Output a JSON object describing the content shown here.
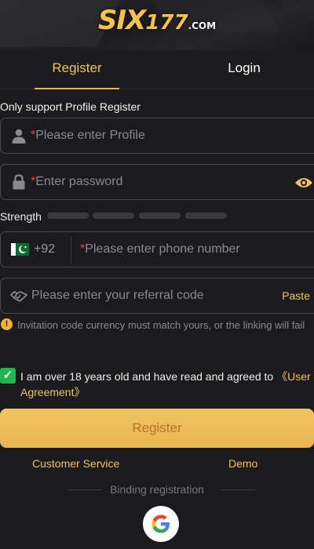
{
  "logo": {
    "main": "SIX",
    "number": "177",
    "suffix": ".COM"
  },
  "tabs": {
    "register": "Register",
    "login": "Login"
  },
  "form": {
    "subtitle": "Only support Profile Register",
    "profile_placeholder": "Please enter Profile",
    "password_placeholder": "Enter password",
    "strength_label": "Strength",
    "phone_prefix": "+92",
    "phone_placeholder": "Please enter phone number",
    "referral_placeholder": "Please enter your referral code",
    "paste_label": "Paste",
    "notice": "Invitation code currency must match yours, or the linking will fail",
    "agree_text": "I am over 18 years old and have read and agreed to ",
    "agree_link": "《User Agreement》",
    "submit": "Register"
  },
  "footer": {
    "customer_service": "Customer Service",
    "demo": "Demo",
    "binding": "Binding registration"
  },
  "colors": {
    "accent": "#f2c15a",
    "button": "#eebd58",
    "check": "#1fb84a",
    "required": "#e0454b"
  },
  "icons": [
    "user-icon",
    "lock-icon",
    "eye-icon",
    "pakistan-flag-icon",
    "handshake-icon",
    "warning-icon",
    "check-icon",
    "google-icon"
  ]
}
